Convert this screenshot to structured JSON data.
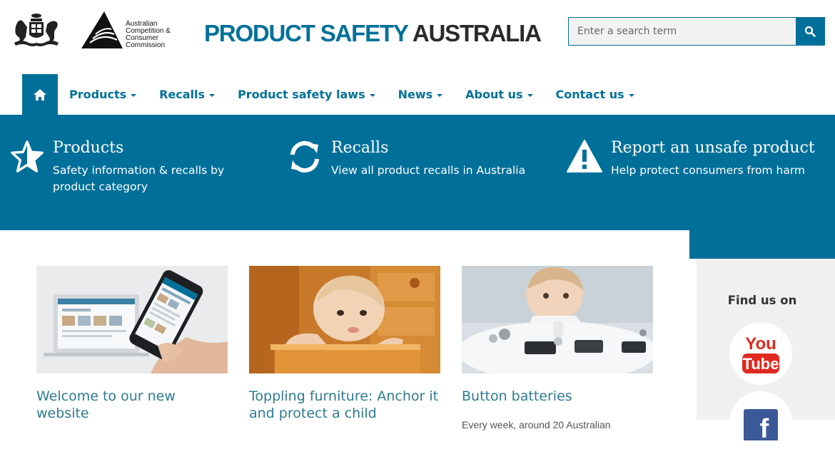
{
  "header": {
    "accc_lines": [
      "Australian",
      "Competition &",
      "Consumer",
      "Commission"
    ],
    "title_part1": "PRODUCT SAFETY",
    "title_part2": "AUSTRALIA",
    "search": {
      "placeholder": "Enter a search term",
      "value": ""
    }
  },
  "nav": {
    "items": [
      {
        "label": "Products"
      },
      {
        "label": "Recalls"
      },
      {
        "label": "Product safety laws"
      },
      {
        "label": "News"
      },
      {
        "label": "About us"
      },
      {
        "label": "Contact us"
      }
    ]
  },
  "banner": {
    "features": [
      {
        "title": "Products",
        "desc": "Safety information & recalls by product category",
        "icon": "star-icon"
      },
      {
        "title": "Recalls",
        "desc": "View all product recalls in Australia",
        "icon": "refresh-icon"
      },
      {
        "title": "Report an unsafe product",
        "desc": "Help protect consumers from harm",
        "icon": "warning-icon"
      }
    ]
  },
  "cards": [
    {
      "title": "Welcome to our new website",
      "body": ""
    },
    {
      "title": "Toppling furniture: Anchor it and protect a child",
      "body": ""
    },
    {
      "title": "Button batteries",
      "body": "Every week, around 20 Australian"
    }
  ],
  "sidebar": {
    "find_us": "Find us on",
    "youtube_top": "You",
    "youtube_bottom": "Tube",
    "facebook": "f"
  },
  "colors": {
    "brand_blue": "#00709a",
    "title_dark": "#2a2a2a",
    "card_title": "#2f7a92"
  }
}
